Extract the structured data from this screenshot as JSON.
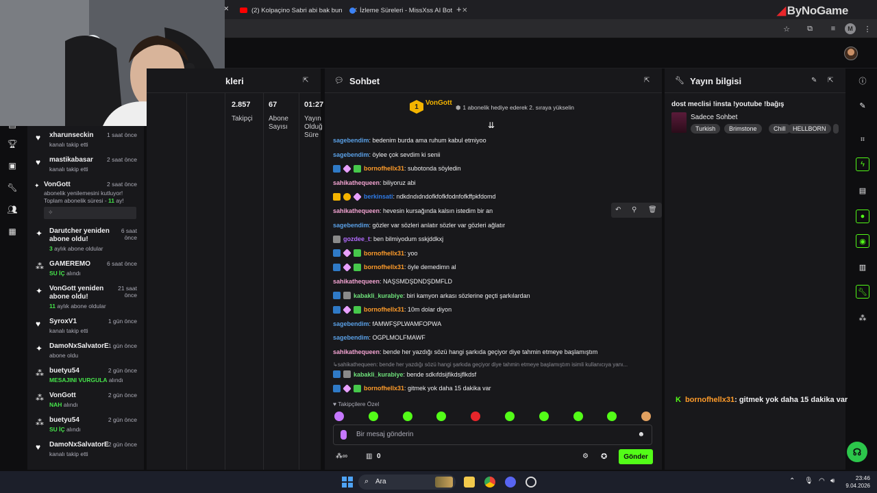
{
  "browser": {
    "tabs": [
      {
        "label": "(2) Kolpaçino Sabri abi bak bun",
        "color": "#ff0000"
      },
      {
        "label": "İzleme Süreleri - MissXss AI Bot",
        "color": "#3b82f6"
      }
    ],
    "new_tab": "+",
    "watermark": "ByNoGame",
    "profile_initial": "M"
  },
  "stats": {
    "title": "kleri",
    "columns": [
      {
        "value": "2.857",
        "label": "Takipçi"
      },
      {
        "value": "67",
        "label": "Abone Sayısı"
      },
      {
        "value": "01:27",
        "label": "Yayın Olduğ Süre"
      }
    ]
  },
  "activity": [
    {
      "icon": "heart-icon",
      "name": "xharunseckin",
      "time": "1 saat önce",
      "sub": "kanalı takip etti"
    },
    {
      "icon": "heart-icon",
      "name": "mastikabasar",
      "time": "2 saat önce",
      "sub": "kanalı takip etti"
    },
    {
      "icon": "sparkle-icon",
      "name": "VonGott",
      "time": "2 saat önce",
      "sub": "abonelik yenilemesini kutluyor! Toplam abonelik süresi - ",
      "sub_hl": "11",
      "sub_tail": " ay!"
    },
    {
      "icon": "sparkle-icon",
      "name": "Darutcher yeniden abone oldu!",
      "time": "6 saat önce",
      "sub_hl": "3",
      "sub": " aylık abone oldular"
    },
    {
      "icon": "gift-icon",
      "name": "GAMEREMO",
      "time": "6 saat önce",
      "sub_hl": "SU İÇ",
      "sub": " alındı"
    },
    {
      "icon": "sparkle-icon",
      "name": "VonGott yeniden abone oldu!",
      "time": "21 saat önce",
      "sub_hl": "11",
      "sub": " aylık abone oldular"
    },
    {
      "icon": "heart-icon",
      "name": "SyroxV1",
      "time": "1 gün önce",
      "sub": "kanalı takip etti"
    },
    {
      "icon": "sparkle-icon",
      "name": "DamoNxSalvatorE",
      "time": "1 gün önce",
      "sub": "abone oldu"
    },
    {
      "icon": "gift-icon",
      "name": "buetyu54",
      "time": "2 gün önce",
      "sub_hl": "MESAJINI VURGULA",
      "sub": " alındı"
    },
    {
      "icon": "gift-icon",
      "name": "VonGott",
      "time": "2 gün önce",
      "sub_hl": "NAH",
      "sub": " alındı"
    },
    {
      "icon": "gift-icon",
      "name": "buetyu54",
      "time": "2 gün önce",
      "sub_hl": "SU İÇ",
      "sub": " alındı"
    },
    {
      "icon": "heart-icon",
      "name": "DamoNxSalvatorE",
      "time": "2 gün önce",
      "sub": "kanalı takip etti"
    }
  ],
  "chat": {
    "title": "Sohbet",
    "pinned": {
      "name": "VonGott",
      "rank": "1",
      "text": "1 abonelik hediye ederek 2. sıraya yükselin"
    },
    "messages": [
      {
        "user": "sagebendim",
        "color": "#5aa0e6",
        "badges": [],
        "text": "bedenim burda ama ruhum kabul etmiyoo"
      },
      {
        "user": "sagebendim",
        "color": "#5aa0e6",
        "badges": [],
        "text": "öylee çok sevdim ki senii"
      },
      {
        "user": "bornofhellx31",
        "color": "#ff9c2a",
        "badges": [
          "blue",
          "dia",
          "green"
        ],
        "text": "subotonda söyledin"
      },
      {
        "user": "sahikathequeen",
        "color": "#f3a4d2",
        "badges": [],
        "text": "biliyoruz abi"
      },
      {
        "user": "berkinsati",
        "color": "#2f7ae5",
        "badges": [
          "gold",
          "circ",
          "dia"
        ],
        "text": "ndkdndıdndofkfofkfodnfofkffpkfdomd"
      },
      {
        "user": "sahikathequeen",
        "color": "#f3a4d2",
        "badges": [],
        "text": "hevesin kursağında kalsın istedim bir an"
      },
      {
        "user": "sagebendim",
        "color": "#5aa0e6",
        "badges": [],
        "text": "gözler var sözleri anlatır sözler var gözleri ağlatır"
      },
      {
        "user": "gozdee_t",
        "color": "#b46cff",
        "badges": [
          "gray"
        ],
        "text": "ben bilmiyodum sskjddkxj"
      },
      {
        "user": "bornofhellx31",
        "color": "#ff9c2a",
        "badges": [
          "blue",
          "dia",
          "green"
        ],
        "text": "yoo"
      },
      {
        "user": "bornofhellx31",
        "color": "#ff9c2a",
        "badges": [
          "blue",
          "dia",
          "green"
        ],
        "text": "öyle demedimn al"
      },
      {
        "user": "sahikathequeen",
        "color": "#f3a4d2",
        "badges": [],
        "text": "NAŞSMDŞDNDŞDMFLD"
      },
      {
        "user": "kabakli_kurabiye",
        "color": "#6ee07a",
        "badges": [
          "blue",
          "gray"
        ],
        "text": "biri kamyon arkası sözlerine geçti şarkılardan"
      },
      {
        "user": "bornofhellx31",
        "color": "#ff9c2a",
        "badges": [
          "blue",
          "dia",
          "green"
        ],
        "text": "10m dolar diyon"
      },
      {
        "user": "sagebendim",
        "color": "#5aa0e6",
        "badges": [],
        "text": "fAMWFŞPLWAMFOPWA"
      },
      {
        "user": "sagebendim",
        "color": "#5aa0e6",
        "badges": [],
        "text": "OGPLMOLFMAWF"
      },
      {
        "user": "sahikathequeen",
        "color": "#f3a4d2",
        "badges": [],
        "text": "bende her yazdığı sözü hangi şarkıda geçiyor diye tahmin etmeye başlamıştım"
      },
      {
        "user": "kabakli_kurabiye",
        "color": "#6ee07a",
        "badges": [
          "blue",
          "gray"
        ],
        "text": "bende sdkıfdsijfikdsjflkdsf",
        "reply": "sahikathequeen: bende her yazdığı sözü hangi şarkıda geçiyor diye tahmin etmeye başlamıştım isimli kullanıcıya yanı..."
      },
      {
        "user": "bornofhellx31",
        "color": "#ff9c2a",
        "badges": [
          "blue",
          "dia",
          "green"
        ],
        "text": "gitmek yok daha 15 dakika var"
      }
    ],
    "followers_only": "Takipçilere Özel",
    "input_placeholder": "Bir mesaj gönderin",
    "points": "0",
    "send_label": "Gönder"
  },
  "info": {
    "title": "Yayın bilgisi",
    "stream_title": "dost meclisi !insta !youtube !bağış",
    "category": "Sadece Sohbet",
    "tags": [
      "Turkish",
      "Brimstone",
      "Chill",
      "HELLBORN"
    ],
    "highlight": {
      "user": "bornofhellx31",
      "text": "gitmek yok daha 15 dakika var"
    }
  },
  "taskbar": {
    "search": "Ara",
    "time": "23:46",
    "date": "9.04.2026"
  },
  "colors": {
    "accent": "#53fc18",
    "panel": "#18181b",
    "bg": "#0e0e10"
  }
}
